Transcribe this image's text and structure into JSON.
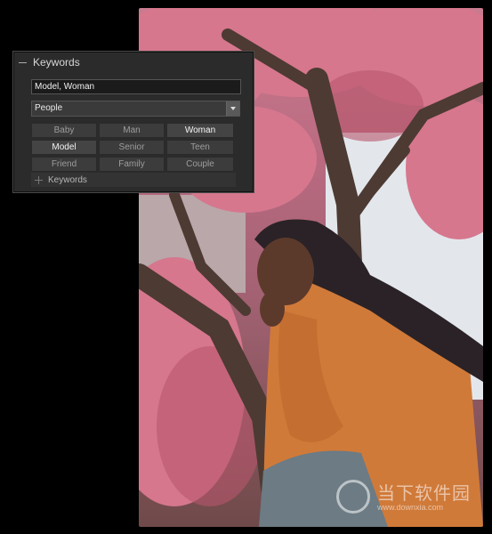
{
  "keywords_panel": {
    "title": "Keywords",
    "keyword_field_value": "Model, Woman",
    "keyword_set_selected": "People",
    "suggestions": [
      {
        "label": "Baby",
        "active": false
      },
      {
        "label": "Man",
        "active": false
      },
      {
        "label": "Woman",
        "active": true
      },
      {
        "label": "Model",
        "active": true
      },
      {
        "label": "Senior",
        "active": false
      },
      {
        "label": "Teen",
        "active": false
      },
      {
        "label": "Friend",
        "active": false
      },
      {
        "label": "Family",
        "active": false
      },
      {
        "label": "Couple",
        "active": false
      }
    ],
    "footer_label": "Keywords"
  },
  "photo": {
    "icon": "portrait-photo",
    "colors": {
      "blossom": "#d7768f",
      "sky": "#dfe6ec",
      "jacket": "#d07a3a",
      "bark": "#4d3a33"
    }
  },
  "watermark": {
    "title": "当下软件园",
    "url": "www.downxia.com"
  }
}
